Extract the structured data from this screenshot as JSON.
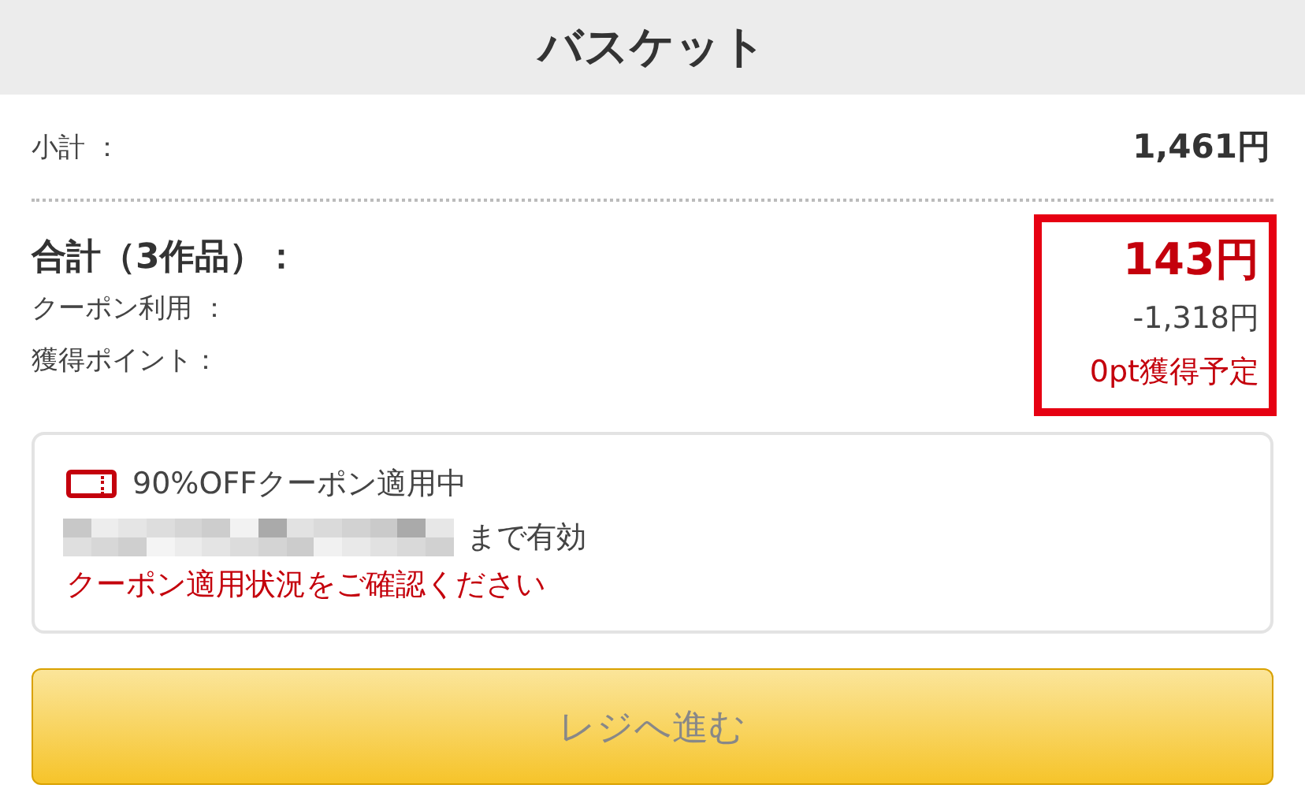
{
  "header": {
    "title": "バスケット"
  },
  "subtotal": {
    "label": "小計 ：",
    "value": "1,461円"
  },
  "summary": {
    "total_label": "合計（3作品）：",
    "total_value": "143円",
    "rows": [
      {
        "label": "クーポン利用 ：",
        "value": "-1,318円",
        "kind": "discount"
      },
      {
        "label": "獲得ポイント：",
        "value": "0pt獲得予定",
        "kind": "points"
      }
    ],
    "highlighted": true
  },
  "coupon": {
    "title": "90%OFFクーポン適用中",
    "expiry_suffix": "まで有効",
    "notice": "クーポン適用状況をご確認ください"
  },
  "checkout_button": {
    "label": "レジへ進む",
    "disabled": true
  }
}
